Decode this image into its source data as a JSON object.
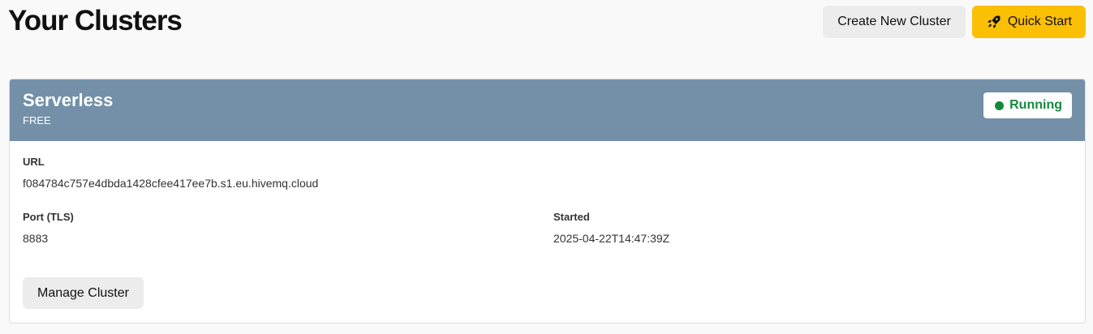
{
  "header": {
    "title": "Your Clusters",
    "create_label": "Create New Cluster",
    "quickstart_label": "Quick Start",
    "quickstart_icon": "rocket-icon"
  },
  "colors": {
    "accent": "#fbbf04",
    "card_header": "#7390a8",
    "status_running": "#158a3f"
  },
  "cluster": {
    "name": "Serverless",
    "plan": "FREE",
    "status": "Running",
    "url_label": "URL",
    "url_value": "f084784c757e4dbda1428cfee417ee7b.s1.eu.hivemq.cloud",
    "port_label": "Port (TLS)",
    "port_value": "8883",
    "started_label": "Started",
    "started_value": "2025-04-22T14:47:39Z",
    "manage_label": "Manage Cluster"
  }
}
